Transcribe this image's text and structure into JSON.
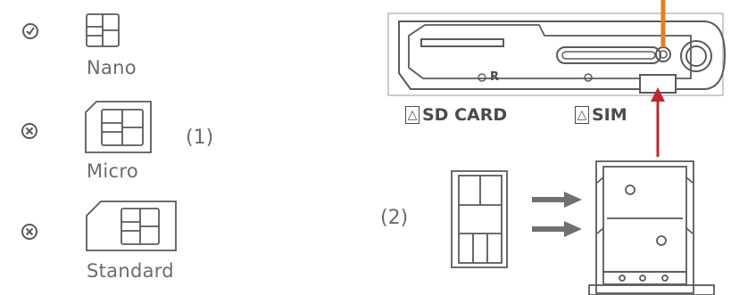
{
  "sim_types": [
    {
      "label": "Nano",
      "status": "ok",
      "status_icon": "check-circle-icon"
    },
    {
      "label": "Micro",
      "status": "no",
      "status_icon": "x-circle-icon"
    },
    {
      "label": "Standard",
      "status": "no",
      "status_icon": "x-circle-icon"
    }
  ],
  "steps": {
    "step1": "(1)",
    "step2": "(2)"
  },
  "device": {
    "sd_card_label": "SD CARD",
    "sim_label": "SIM",
    "reset_label": "R"
  },
  "colors": {
    "line": "#5a5a5a",
    "arrow_red": "#c0262d",
    "arrow_orange": "#e67e22",
    "arrow_grey": "#707070"
  }
}
